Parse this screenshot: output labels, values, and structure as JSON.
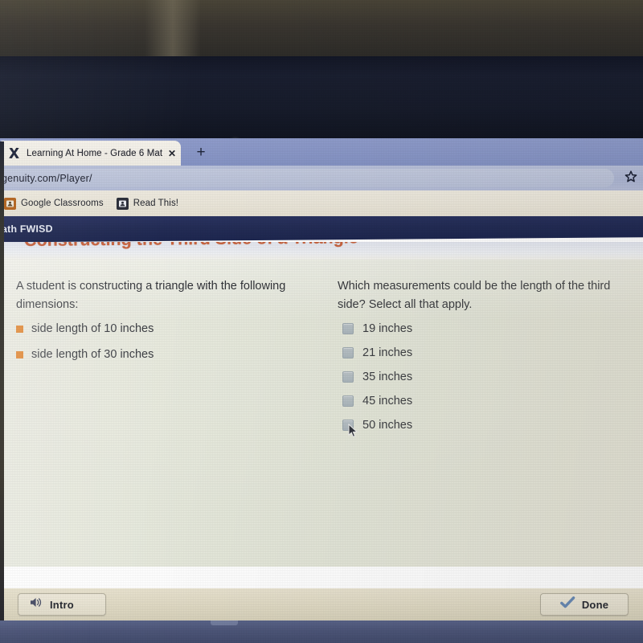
{
  "browser": {
    "tab": {
      "favicon": "edgenuity-x-icon",
      "title": "Learning At Home - Grade 6 Mat",
      "close_label": "✕"
    },
    "new_tab_label": "+",
    "address_bar": {
      "url": "genuity.com/Player/",
      "bookmark_icon": "star-icon"
    },
    "bookmarks": [
      {
        "label": "Google Classrooms",
        "icon": "bookmark-folder-icon"
      },
      {
        "label": "Read This!",
        "icon": "bookmark-folder-icon"
      }
    ]
  },
  "app": {
    "navbar_title": "ath FWISD",
    "lesson_title": "Constructing the Third Side of a Triangle",
    "colors": {
      "navbar": "#232c55",
      "lesson_title": "#c9643f",
      "bullet": "#e07c1d",
      "done_check": "#5f7fa8"
    }
  },
  "left_panel": {
    "prompt": "A student is constructing a triangle with the following dimensions:",
    "bullets": [
      "side length of 10 inches",
      "side length of 30 inches"
    ]
  },
  "right_panel": {
    "question": "Which measurements could be the length of the third side? Select all that apply.",
    "choices": [
      {
        "label": "19 inches",
        "checked": false
      },
      {
        "label": "21 inches",
        "checked": false
      },
      {
        "label": "35 inches",
        "checked": false
      },
      {
        "label": "45 inches",
        "checked": false
      },
      {
        "label": "50 inches",
        "checked": false
      }
    ]
  },
  "footer": {
    "intro_button": {
      "label": "Intro",
      "icon": "speaker-icon"
    },
    "done_button": {
      "label": "Done",
      "icon": "checkmark-icon"
    }
  }
}
